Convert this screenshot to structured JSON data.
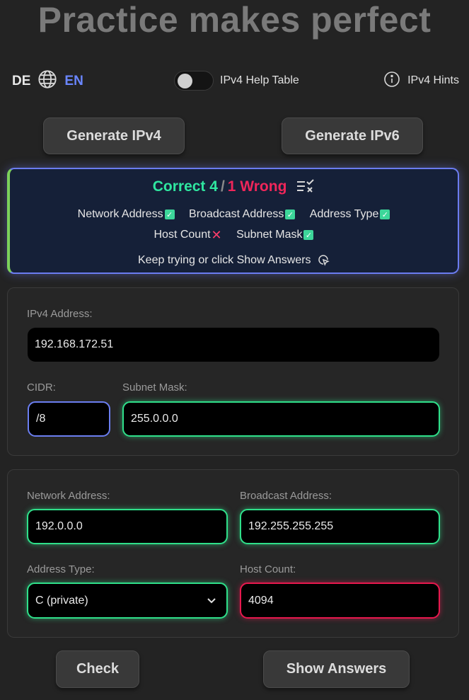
{
  "header": {
    "title": "Practice makes perfect"
  },
  "lang": {
    "de": "DE",
    "en": "EN",
    "globe_icon": "globe-icon"
  },
  "help_toggle": {
    "label": "IPv4 Help Table",
    "checked": false
  },
  "hints": {
    "label": "IPv4 Hints",
    "icon": "info-icon"
  },
  "buttons": {
    "generate_ipv4": "Generate IPv4",
    "generate_ipv6": "Generate IPv6",
    "check": "Check",
    "show_answers": "Show Answers"
  },
  "result": {
    "correct_label": "Correct 4",
    "slash": "/",
    "wrong_label": "1 Wrong",
    "items": [
      {
        "label": "Network Address",
        "status": "correct"
      },
      {
        "label": "Broadcast Address",
        "status": "correct"
      },
      {
        "label": "Address Type",
        "status": "correct"
      },
      {
        "label": "Host Count",
        "status": "wrong"
      },
      {
        "label": "Subnet Mask",
        "status": "correct"
      }
    ],
    "hint": "Keep trying or click Show Answers",
    "colors": {
      "correct": "#2fe6a0",
      "wrong": "#f0265a",
      "border": "#6b7cf0"
    }
  },
  "inputs": {
    "ipv4_address": {
      "label": "IPv4 Address:",
      "value": "192.168.172.51"
    },
    "cidr": {
      "label": "CIDR:",
      "value": "/8"
    },
    "subnet_mask": {
      "label": "Subnet Mask:",
      "value": "255.0.0.0"
    },
    "network_address": {
      "label": "Network Address:",
      "value": "192.0.0.0"
    },
    "broadcast_address": {
      "label": "Broadcast Address:",
      "value": "192.255.255.255"
    },
    "address_type": {
      "label": "Address Type:",
      "value": "C (private)"
    },
    "host_count": {
      "label": "Host Count:",
      "value": "4094"
    }
  }
}
